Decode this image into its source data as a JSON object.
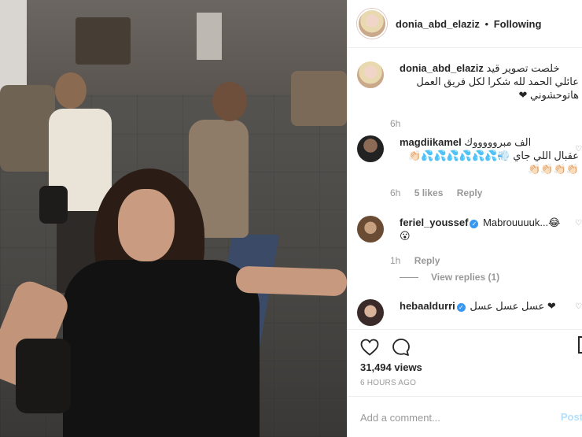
{
  "header": {
    "username": "donia_abd_elaziz",
    "separator": "•",
    "follow_status": "Following"
  },
  "comments": {
    "owner": {
      "username": "donia_abd_elaziz",
      "text_line1": "خلصت تصوير قيد",
      "text_line2": "عائلي الحمد لله شكرا لكل فريق العمل",
      "text_line3": "هاتوحشوني ❤",
      "time": "6h"
    },
    "magdi": {
      "username": "magdiikamel",
      "text_line1": "الف مبروووووك",
      "text_line2": "عقبال اللي جاي 💨💦💦💦💦💦💦👏🏻",
      "text_line3": "👏🏻👏🏻👏🏻👏🏻",
      "time": "6h",
      "likes": "5 likes",
      "reply": "Reply"
    },
    "feriel": {
      "username": "feriel_youssef",
      "text": "Mabrouuuuk...😂",
      "text_line2": "😮",
      "time": "1h",
      "reply": "Reply",
      "view_replies": "View replies (1)"
    },
    "heba": {
      "username": "hebaaldurri",
      "text": "عسل عسل عسل ❤"
    }
  },
  "actions": {
    "views": "31,494 views",
    "ago": "6 HOURS AGO"
  },
  "add_comment": {
    "placeholder": "Add a comment...",
    "post": "Post"
  },
  "icons": {
    "like": "heart-outline-icon",
    "comment": "speech-bubble-icon",
    "save": "bookmark-icon"
  }
}
